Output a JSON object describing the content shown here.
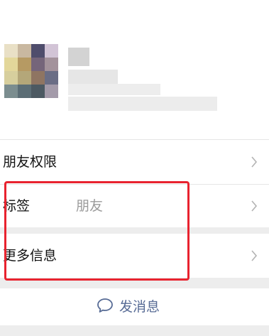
{
  "profile": {
    "avatar_colors": [
      "#e9e0c6",
      "#c9b8a0",
      "#4f4d6c",
      "#d2c4d6",
      "#e3d79a",
      "#b69a63",
      "#75657a",
      "#a3929b",
      "#d7cf9d",
      "#b4a779",
      "#8f7562",
      "#6a6d85",
      "#7b8d8f",
      "#5b6d75",
      "#4c5962",
      "#a39aa9"
    ],
    "blur_color": "#e4e4e4"
  },
  "rows": {
    "friend_permissions": {
      "label": "朋友权限"
    },
    "tags": {
      "label": "标签",
      "value": "朋友"
    },
    "more_info": {
      "label": "更多信息"
    }
  },
  "actions": {
    "send_message_label": "发消息",
    "send_message_icon": "chat-bubble-icon",
    "accent": "#576b95"
  },
  "annotation": {
    "highlight_color": "#e8232f"
  }
}
